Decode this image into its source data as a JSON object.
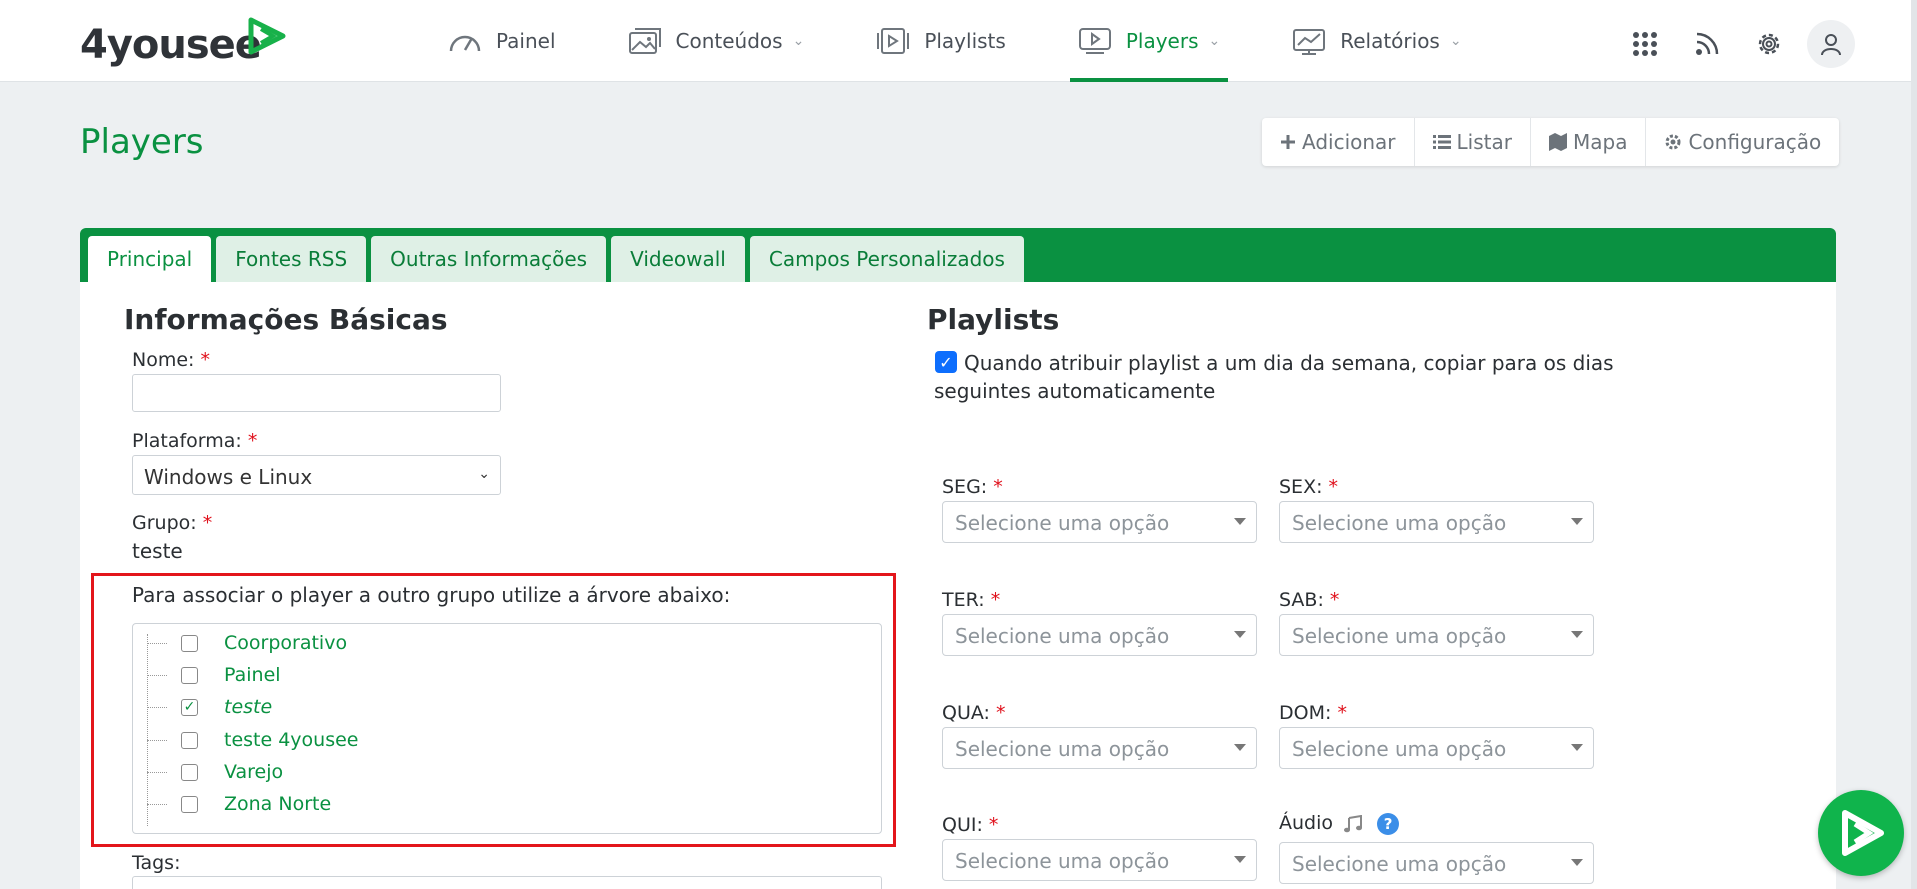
{
  "brand": {
    "name": "4yousee"
  },
  "nav": {
    "items": [
      {
        "label": "Painel",
        "icon": "speedometer-icon",
        "has_dropdown": false,
        "active": false
      },
      {
        "label": "Conteúdos",
        "icon": "images-icon",
        "has_dropdown": true,
        "active": false
      },
      {
        "label": "Playlists",
        "icon": "playlist-icon",
        "has_dropdown": false,
        "active": false
      },
      {
        "label": "Players",
        "icon": "player-icon",
        "has_dropdown": true,
        "active": true
      },
      {
        "label": "Relatórios",
        "icon": "report-icon",
        "has_dropdown": true,
        "active": false
      }
    ],
    "right_icons": [
      "apps-grid-icon",
      "rss-icon",
      "gear-icon",
      "user-icon"
    ]
  },
  "header": {
    "title": "Players",
    "actions": [
      {
        "label": "Adicionar",
        "icon": "plus-icon"
      },
      {
        "label": "Listar",
        "icon": "list-icon"
      },
      {
        "label": "Mapa",
        "icon": "map-icon"
      },
      {
        "label": "Configuração",
        "icon": "gear-icon"
      }
    ]
  },
  "tabs": [
    "Principal",
    "Fontes RSS",
    "Outras Informações",
    "Videowall",
    "Campos Personalizados"
  ],
  "active_tab": "Principal",
  "basic": {
    "title": "Informações Básicas",
    "name_label": "Nome:",
    "name_value": "",
    "platform_label": "Plataforma:",
    "platform_value": "Windows e Linux",
    "group_label": "Grupo:",
    "group_value": "teste",
    "tree_instruction": "Para associar o player a outro grupo utilize a árvore abaixo:",
    "tree": [
      {
        "label": "Coorporativo",
        "checked": false
      },
      {
        "label": "Painel",
        "checked": false
      },
      {
        "label": "teste",
        "checked": true
      },
      {
        "label": "teste 4yousee",
        "checked": false
      },
      {
        "label": "Varejo",
        "checked": false
      },
      {
        "label": "Zona Norte",
        "checked": false
      }
    ],
    "tags_label": "Tags:",
    "required_mark": "*"
  },
  "playlists": {
    "title": "Playlists",
    "copy_checkbox_checked": true,
    "copy_checkbox_text": "Quando atribuir playlist a um dia da semana, copiar para os dias seguintes automaticamente",
    "placeholder": "Selecione uma opção",
    "days": [
      {
        "label": "SEG:",
        "required": true
      },
      {
        "label": "SEX:",
        "required": true
      },
      {
        "label": "TER:",
        "required": true
      },
      {
        "label": "SAB:",
        "required": true
      },
      {
        "label": "QUA:",
        "required": true
      },
      {
        "label": "DOM:",
        "required": true
      },
      {
        "label": "QUI:",
        "required": true
      },
      {
        "label": "Áudio",
        "required": false
      }
    ],
    "audio_icons": [
      "music-note-icon",
      "help-icon"
    ],
    "help_glyph": "?"
  },
  "colors": {
    "brand_green": "#0a9141",
    "highlight_red": "#e3151b",
    "checkbox_blue": "#0d6efd"
  }
}
